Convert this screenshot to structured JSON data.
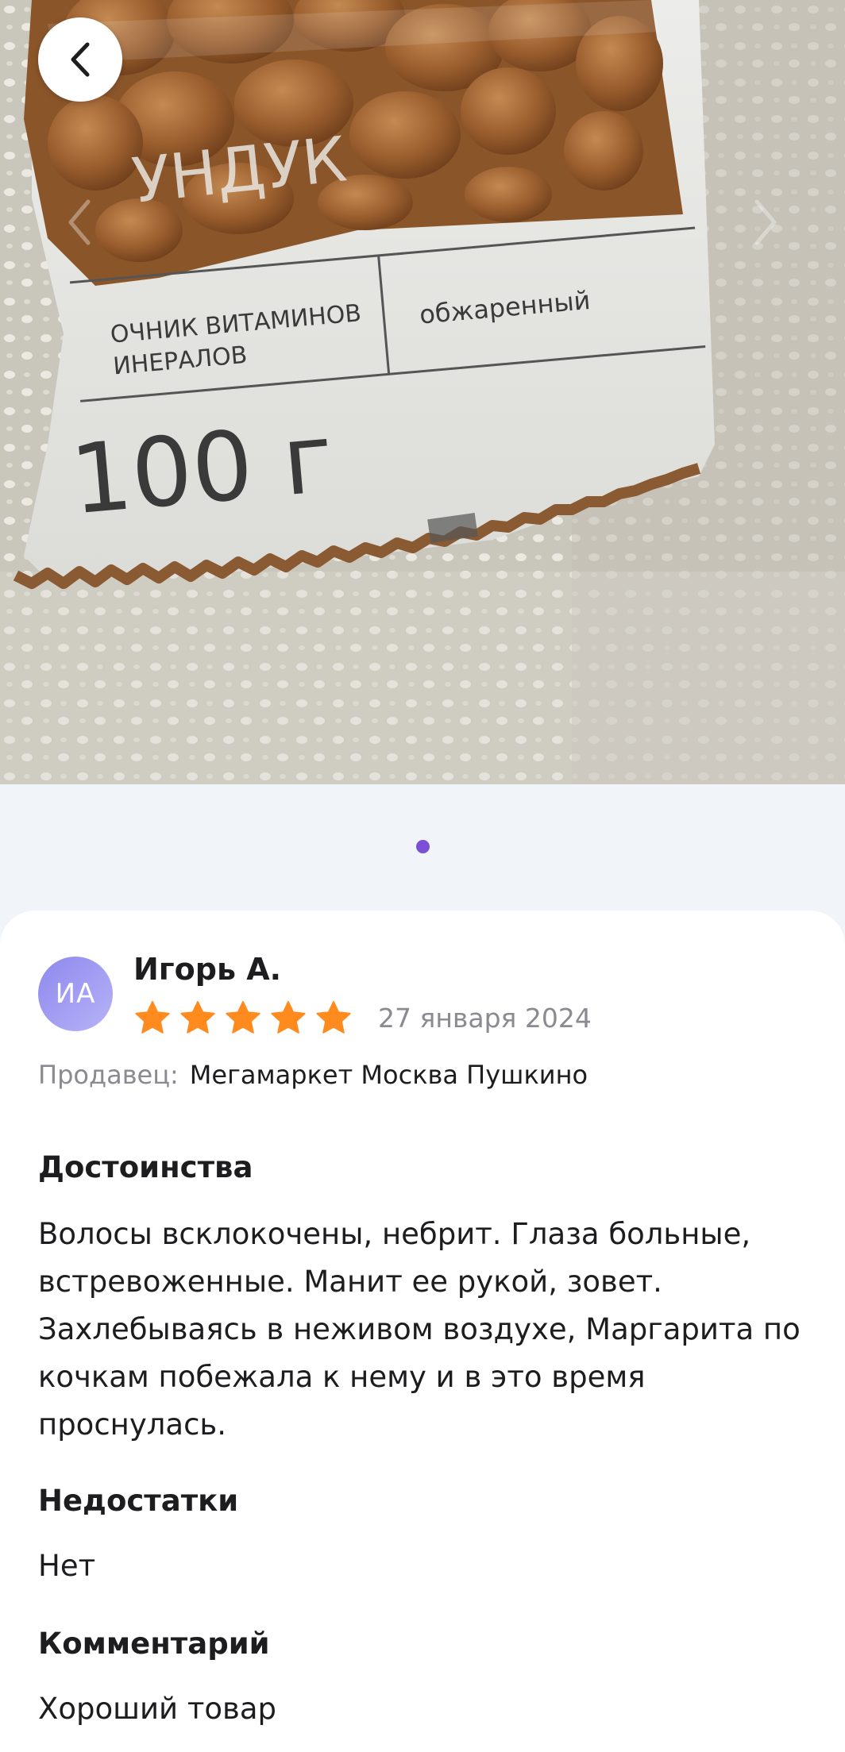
{
  "photo": {
    "alt_package_text_1": "УНДУК",
    "alt_package_text_2": "ОЧНИК ВИТАМИНОВ",
    "alt_package_text_3": "ИНЕРАЛОВ",
    "alt_package_text_4": "обжаренный",
    "alt_package_text_5": "100 г"
  },
  "gallery": {
    "current": 1,
    "total": 1,
    "dot_color": "#7b4fd6"
  },
  "review": {
    "avatar_initials": "ИА",
    "author": "Игорь А.",
    "rating": 5,
    "rating_max": 5,
    "star_color": "#ff8a1e",
    "date": "27 января 2024",
    "seller_label": "Продавец:",
    "seller_name": "Мегамаркет Москва Пушкино",
    "advantages_title": "Достоинства",
    "advantages_text": "Волосы всклокочены, небрит. Глаза больные, встревоженные. Манит ее рукой, зовет. Захлебываясь в неживом воздухе, Маргарита по кочкам побежала к нему и в это время проснулась.",
    "disadvantages_title": "Недостатки",
    "disadvantages_text": "Нет",
    "comment_title": "Комментарий",
    "comment_text": "Хороший товар"
  }
}
